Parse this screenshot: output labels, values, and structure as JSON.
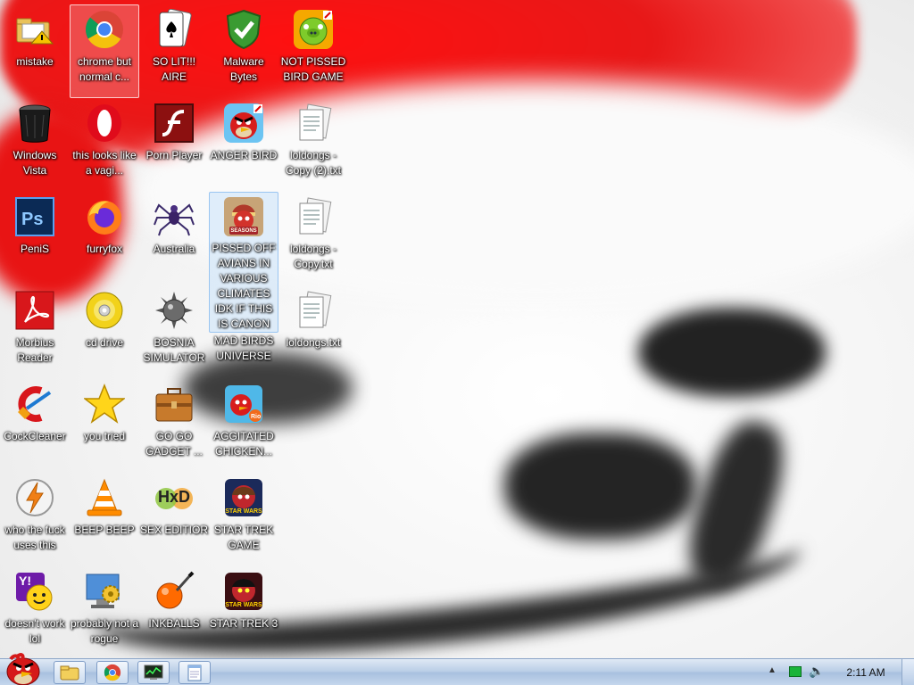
{
  "desktop": {
    "icons": [
      {
        "label": "mistake",
        "icon": "folder-warning-icon"
      },
      {
        "label": "chrome but normal c...",
        "icon": "chrome-icon"
      },
      {
        "label": "SO LIT!!! AIRE",
        "icon": "solitaire-icon"
      },
      {
        "label": "Malware Bytes",
        "icon": "shield-check-icon"
      },
      {
        "label": "NOT PISSED BIRD GAME",
        "icon": "green-pig-icon"
      },
      {
        "label": "Windows Vista",
        "icon": "trash-bin-icon"
      },
      {
        "label": "this looks like a vagi...",
        "icon": "opera-icon"
      },
      {
        "label": "Porn Player",
        "icon": "flash-player-icon"
      },
      {
        "label": "ANGER BIRD",
        "icon": "angry-bird-icon"
      },
      {
        "label": "loldongs - Copy (2).txt",
        "icon": "text-file-icon"
      },
      {
        "label": "PeniS",
        "icon": "photoshop-icon"
      },
      {
        "label": "furryfox",
        "icon": "firefox-icon"
      },
      {
        "label": "Australia",
        "icon": "spider-icon"
      },
      {
        "label": "PISSED OFF AVIANS IN VARIOUS CLIMATES IDK IF THIS IS CANON",
        "icon": "angry-birds-seasons-icon",
        "badge": "SEASONS"
      },
      {
        "label": "loldongs - Copy.txt",
        "icon": "text-file-icon"
      },
      {
        "label": "Morbius Reader",
        "icon": "acrobat-icon"
      },
      {
        "label": "cd drive",
        "icon": "cd-drive-icon"
      },
      {
        "label": "BOSNIA SIMULATOR",
        "icon": "mine-icon"
      },
      {
        "label": "MAD BIRDS UNIVERSE",
        "icon": "none"
      },
      {
        "label": "loldongs.txt",
        "icon": "text-file-icon"
      },
      {
        "label": "CockCleaner",
        "icon": "ccleaner-icon"
      },
      {
        "label": "you tried",
        "icon": "star-icon"
      },
      {
        "label": "GO GO GADGET ...",
        "icon": "briefcase-icon"
      },
      {
        "label": "AGGITATED CHICKEN...",
        "icon": "angry-birds-rio-icon"
      },
      {
        "label": "who the fuck uses this",
        "icon": "winamp-bolt-icon"
      },
      {
        "label": "BEEP BEEP",
        "icon": "vlc-cone-icon"
      },
      {
        "label": "SEX EDITIOR",
        "icon": "hxd-icon",
        "badge": "HxD"
      },
      {
        "label": "STAR TREK GAME",
        "icon": "angry-birds-star-wars-icon",
        "badge": "STAR WARS"
      },
      {
        "label": "doesn't work lol",
        "icon": "yahoo-messenger-icon",
        "badge": "Y!"
      },
      {
        "label": "probably not a rogue",
        "icon": "monitor-gears-icon"
      },
      {
        "label": "INKBALLS",
        "icon": "inkball-icon"
      },
      {
        "label": "STAR TREK 3",
        "icon": "angry-birds-star-wars-2-icon",
        "badge": "STAR WARS"
      }
    ]
  },
  "taskbar": {
    "start_icon": "angry-bird-start-icon",
    "buttons": [
      {
        "icon": "explorer-folder-icon"
      },
      {
        "icon": "chrome-icon"
      },
      {
        "icon": "task-manager-icon"
      },
      {
        "icon": "notepad-icon"
      }
    ],
    "tray": {
      "show_hidden_glyph": "▲",
      "volume_glyph": "🔈",
      "clock": "2:11 AM"
    }
  },
  "colors": {
    "hat_red": "#e81818",
    "taskbar": "#b9cde6",
    "selection_red": "#ec7878",
    "selection_blue": "#c8e1fa"
  }
}
